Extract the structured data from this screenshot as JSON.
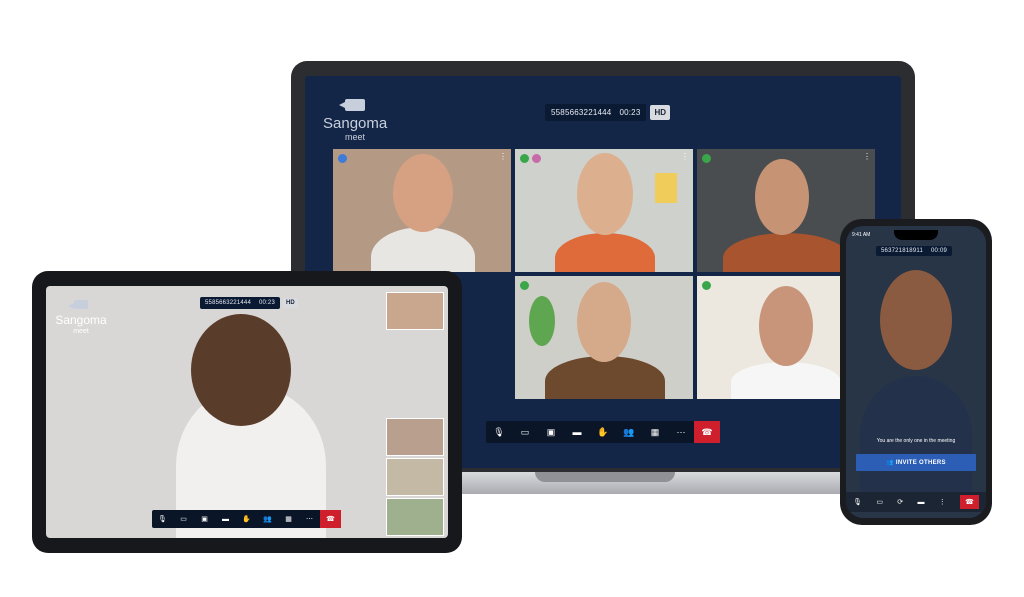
{
  "brand": {
    "name": "Sangoma",
    "sub": "meet"
  },
  "laptop": {
    "meeting_id": "5585663221444",
    "timer": "00:23",
    "quality": "HD",
    "toolbar": [
      "mic-off",
      "camera-off",
      "share",
      "chat",
      "raise-hand",
      "participants",
      "tile-view",
      "more",
      "end-call"
    ]
  },
  "tablet": {
    "meeting_id": "5585663221444",
    "timer": "00:23",
    "quality": "HD",
    "toolbar": [
      "mic-off",
      "camera-off",
      "share",
      "chat",
      "raise-hand",
      "participants",
      "tile-view",
      "more",
      "end-call"
    ]
  },
  "phone": {
    "status_time": "9:41 AM",
    "meeting_id": "563721818911",
    "timer": "00:09",
    "notice": "You are the only one in the meeting",
    "invite_label": "INVITE OTHERS",
    "toolbar": [
      "mic",
      "camera",
      "switch-camera",
      "chat",
      "more",
      "end-call"
    ]
  },
  "colors": {
    "screen_bg": "#142648",
    "end_call": "#cf1f2c",
    "invite": "#2d5eb5"
  }
}
